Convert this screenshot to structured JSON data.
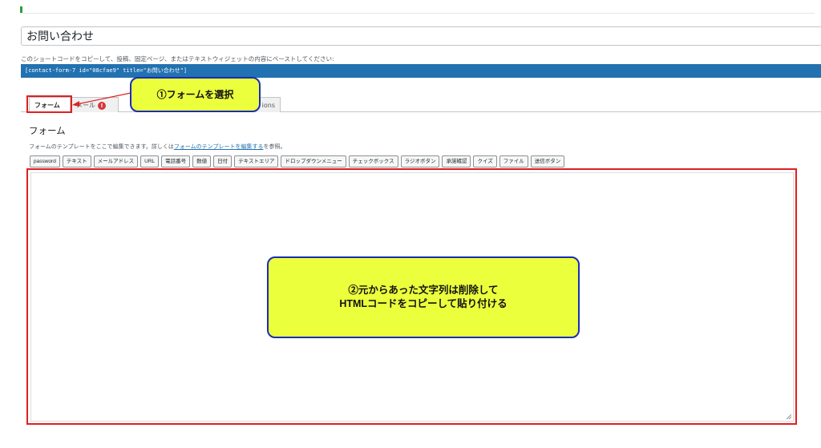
{
  "form_title": "お問い合わせ",
  "shortcode_hint": "このショートコードをコピーして、投稿、固定ページ、またはテキストウィジェットの内容にペーストしてください:",
  "shortcode": "[contact-form-7 id=\"08cfae9\" title=\"お問い合わせ\"]",
  "tabs": {
    "form": "フォーム",
    "mail": "メール",
    "mail_badge": "!",
    "other": "ions"
  },
  "panel": {
    "heading": "フォーム",
    "desc_prefix": "フォームのテンプレートをここで編集できます。詳しくは",
    "desc_link": "フォームのテンプレートを編集する",
    "desc_suffix": "を参照。"
  },
  "tag_buttons": [
    "password",
    "テキスト",
    "メールアドレス",
    "URL",
    "電話番号",
    "数値",
    "日付",
    "テキストエリア",
    "ドロップダウンメニュー",
    "チェックボックス",
    "ラジオボタン",
    "承諾確認",
    "クイズ",
    "ファイル",
    "送信ボタン"
  ],
  "form_template_text": "",
  "annotations": {
    "step1": "①フォームを選択",
    "step2_line1": "②元からあった文字列は削除して",
    "step2_line2": "HTMLコードをコピーして貼り付ける"
  },
  "colors": {
    "accent": "#2271b1",
    "highlight_red": "#e02020",
    "callout_fill": "#ecff3c",
    "callout_border": "#1a2db5"
  }
}
